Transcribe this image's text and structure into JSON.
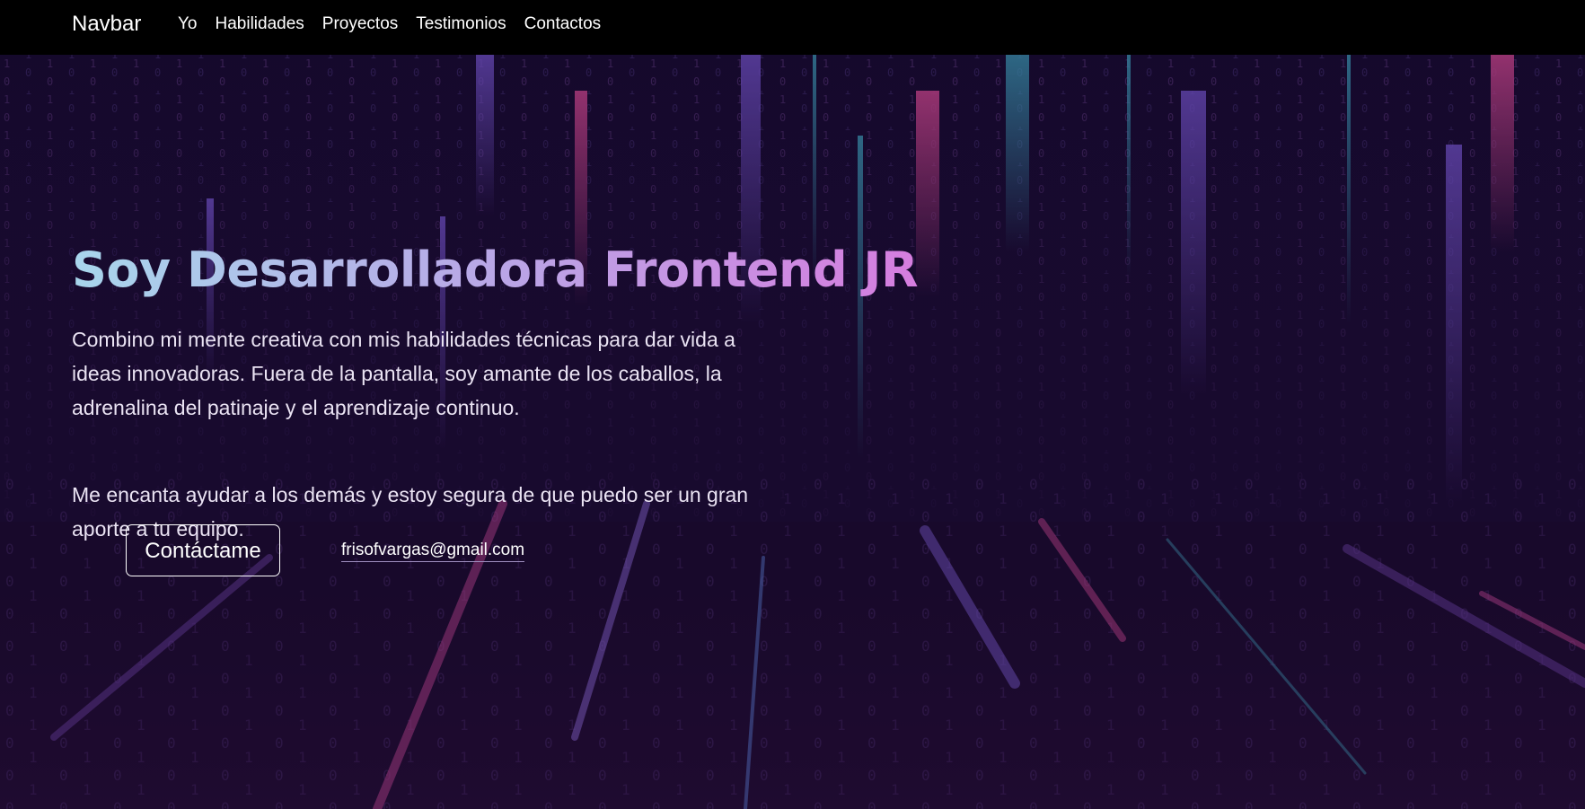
{
  "navbar": {
    "brand": "Navbar",
    "links": [
      "Yo",
      "Habilidades",
      "Proyectos",
      "Testimonios",
      "Contactos"
    ],
    "background": "#000000"
  },
  "hero": {
    "title": "Soy Desarrolladora Frontend JR",
    "paragraph_1": "Combino mi mente creativa con mis habilidades técnicas para dar vida a ideas innovadoras. Fuera de la pantalla, soy amante de los caballos, la adrenalina del patinaje y el aprendizaje continuo.",
    "paragraph_2": "Me encanta ayudar a los demás y estoy segura de que puedo ser un gran aporte a tu equipo.",
    "cta_label": "Contáctame",
    "email": "frisofvargas@gmail.com",
    "title_gradient": [
      "#a8d6ec",
      "#b9a6e6",
      "#d67ddf"
    ],
    "background_image": "binary-code-rain"
  }
}
